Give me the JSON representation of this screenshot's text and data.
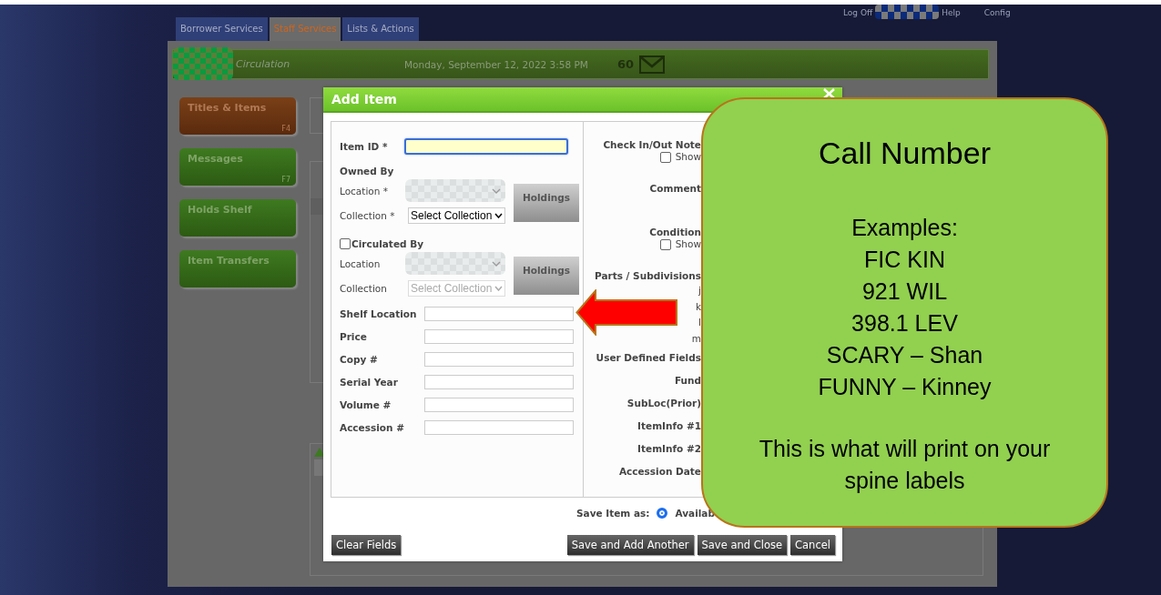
{
  "top_links": [
    {
      "label": "Log Off"
    },
    {
      "label": "Help"
    },
    {
      "label": "Config"
    }
  ],
  "nav_tabs": [
    {
      "label": "Borrower Services",
      "selected": false
    },
    {
      "label": "Staff Services",
      "selected": true
    },
    {
      "label": "Lists & Actions",
      "selected": false
    }
  ],
  "header": {
    "module": "Circulation",
    "datetime": "Monday, September 12, 2022 3:58 PM",
    "count": "60"
  },
  "sidebar": [
    {
      "label": "Titles & Items",
      "key": "F4",
      "selected": true
    },
    {
      "label": "Messages",
      "key": "F7",
      "selected": false
    },
    {
      "label": "Holds Shelf",
      "selected": false
    },
    {
      "label": "Item Transfers",
      "selected": false
    }
  ],
  "dialog": {
    "title": "Add Item",
    "item_id": {
      "label": "Item ID *",
      "focused": true
    },
    "groups": [
      {
        "title": "Owned By",
        "location_label": "Location *",
        "collection_label": "Collection *",
        "collection_value": "Select Collection",
        "disabled": false,
        "button": "Holdings"
      },
      {
        "title": "Circulated By",
        "checked": false,
        "location_label": "Location",
        "collection_label": "Collection",
        "collection_value": "Select Collection",
        "disabled": true,
        "button": "Holdings"
      }
    ],
    "text_fields": [
      {
        "label": "Shelf Location"
      },
      {
        "label": "Price"
      },
      {
        "label": "Copy #"
      },
      {
        "label": "Serial Year"
      },
      {
        "label": "Volume #"
      },
      {
        "label": "Accession #"
      }
    ],
    "right_fields": [
      {
        "kind": "note",
        "label": "Check In/Out Note",
        "option": "Show",
        "checked": false
      },
      {
        "kind": "text",
        "label": "Comment"
      },
      {
        "kind": "note",
        "label": "Condition",
        "option": "Show",
        "checked": false
      },
      {
        "kind": "list",
        "label": "Parts / Subdivisions",
        "items": [
          "j",
          "k",
          "l",
          "m"
        ]
      },
      {
        "kind": "field",
        "label": "User Defined Fields"
      },
      {
        "kind": "field",
        "label": "Fund"
      },
      {
        "kind": "field",
        "label": "SubLoc(Prior)"
      },
      {
        "kind": "field",
        "label": "ItemInfo #1"
      },
      {
        "kind": "field",
        "label": "ItemInfo #2"
      },
      {
        "kind": "field",
        "label": "Accession Date"
      }
    ],
    "save_as": {
      "label": "Save Item as:",
      "option": "Availab",
      "selected": true
    },
    "buttons_left": [
      "Clear Fields"
    ],
    "buttons_right": [
      "Save and Add Another",
      "Save and Close",
      "Cancel"
    ]
  },
  "callout": {
    "title": "Call Number",
    "heading": "Examples:",
    "examples": [
      "FIC KIN",
      "921 WIL",
      "398.1 LEV",
      "SCARY – Shan",
      "FUNNY – Kinney"
    ],
    "note": "This is what will print on your spine labels"
  }
}
